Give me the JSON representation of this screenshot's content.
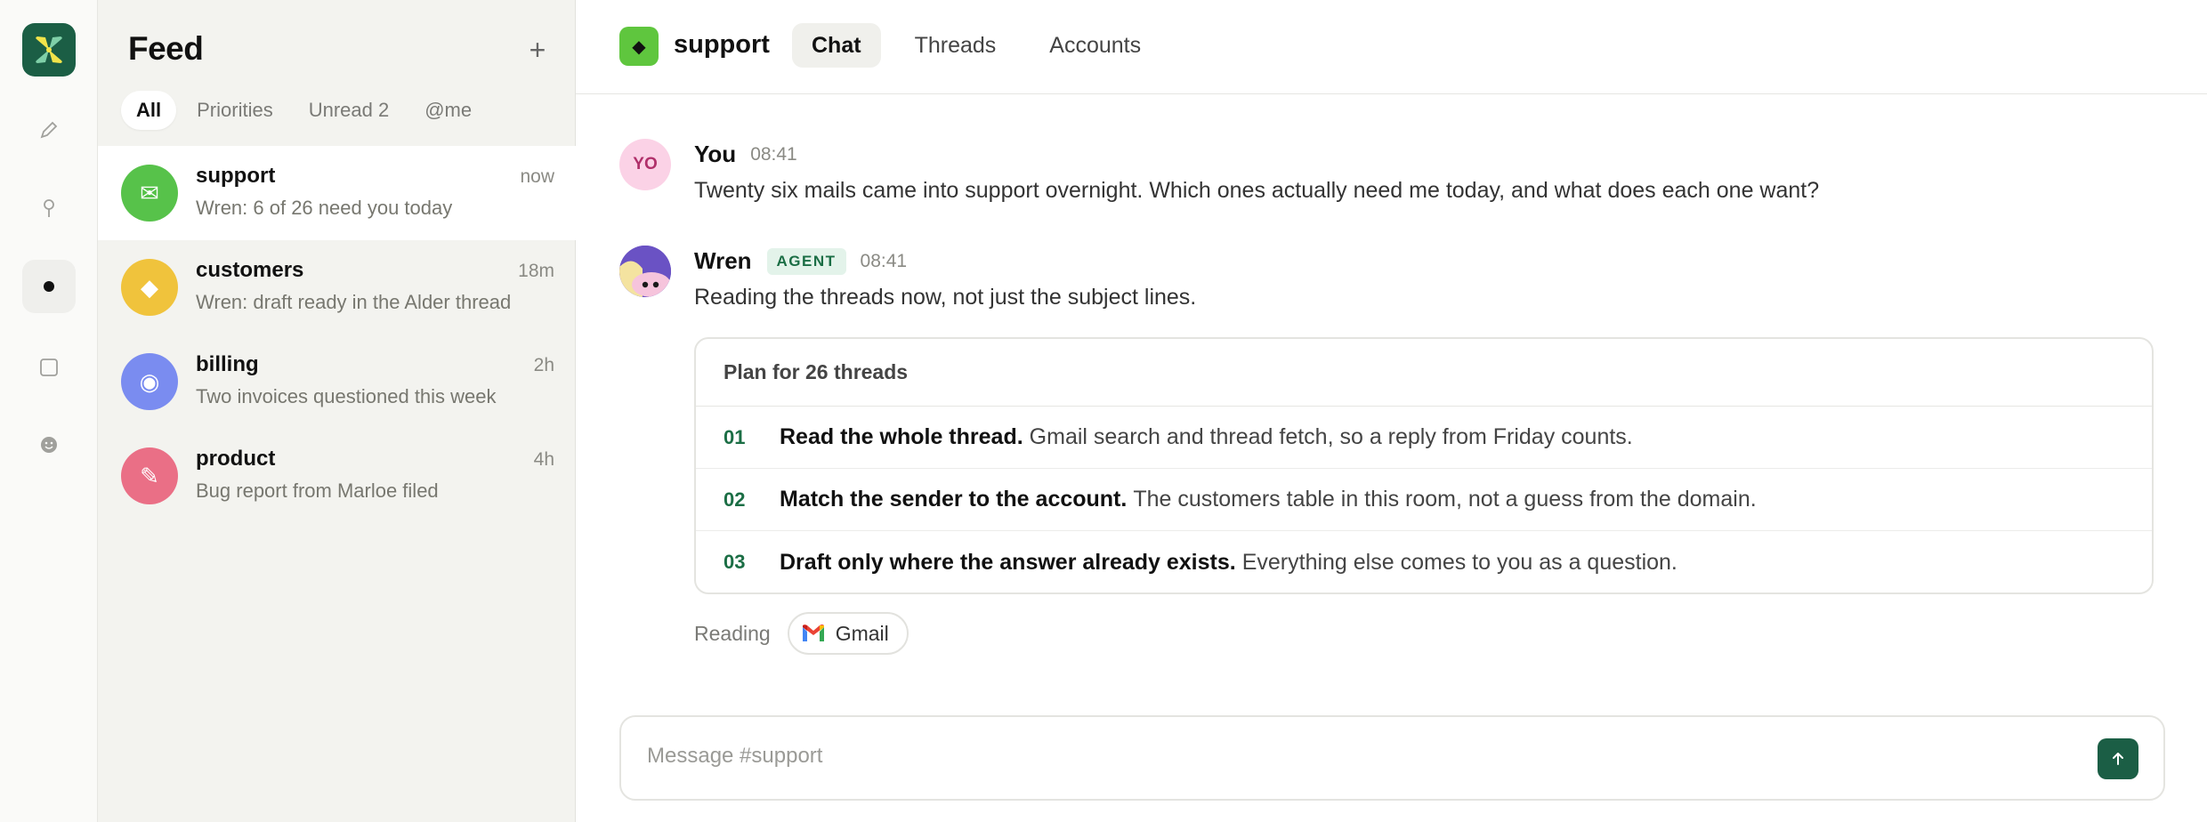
{
  "rail": {
    "items": [
      {
        "icon": "pencil-icon"
      },
      {
        "icon": "pin-icon"
      },
      {
        "icon": "dot-icon"
      },
      {
        "icon": "square-icon"
      },
      {
        "icon": "smiley-icon"
      }
    ]
  },
  "feed": {
    "title": "Feed",
    "add_label": "+",
    "filters": [
      "All",
      "Priorities",
      "Unread 2",
      "@me"
    ],
    "channels": [
      {
        "name": "support",
        "preview": "Wren: 6 of 26 need you today",
        "time": "now",
        "color": "#57c24a",
        "glyph": "✉"
      },
      {
        "name": "customers",
        "preview": "Wren: draft ready in the Alder thread",
        "time": "18m",
        "color": "#f0c33c",
        "glyph": "◆"
      },
      {
        "name": "billing",
        "preview": "Two invoices questioned this week",
        "time": "2h",
        "color": "#7a8cf0",
        "glyph": "◉"
      },
      {
        "name": "product",
        "preview": "Bug report from Marloe filed",
        "time": "4h",
        "color": "#ea6f86",
        "glyph": "✎"
      }
    ]
  },
  "header": {
    "room_glyph": "◆",
    "room_name": "support",
    "tabs": [
      "Chat",
      "Threads",
      "Accounts"
    ]
  },
  "messages": [
    {
      "avatar": "YO",
      "author": "You",
      "time": "08:41",
      "text": "Twenty six mails came into support overnight. Which ones actually need me today, and what does each one want?"
    },
    {
      "author": "Wren",
      "badge": "AGENT",
      "time": "08:41",
      "text": "Reading the threads now, not just the subject lines."
    }
  ],
  "plan": {
    "title": "Plan for 26 threads",
    "steps": [
      {
        "num": "01",
        "bold": "Read the whole thread.",
        "rest": "Gmail search and thread fetch, so a reply from Friday counts."
      },
      {
        "num": "02",
        "bold": "Match the sender to the account.",
        "rest": "The customers table in this room, not a guess from the domain."
      },
      {
        "num": "03",
        "bold": "Draft only where the answer already exists.",
        "rest": "Everything else comes to you as a question."
      }
    ]
  },
  "reading": {
    "label": "Reading",
    "tool": "Gmail"
  },
  "composer": {
    "placeholder": "Message #support"
  },
  "colors": {
    "brand": "#1b5e45",
    "accent_green": "#1b6e45"
  }
}
